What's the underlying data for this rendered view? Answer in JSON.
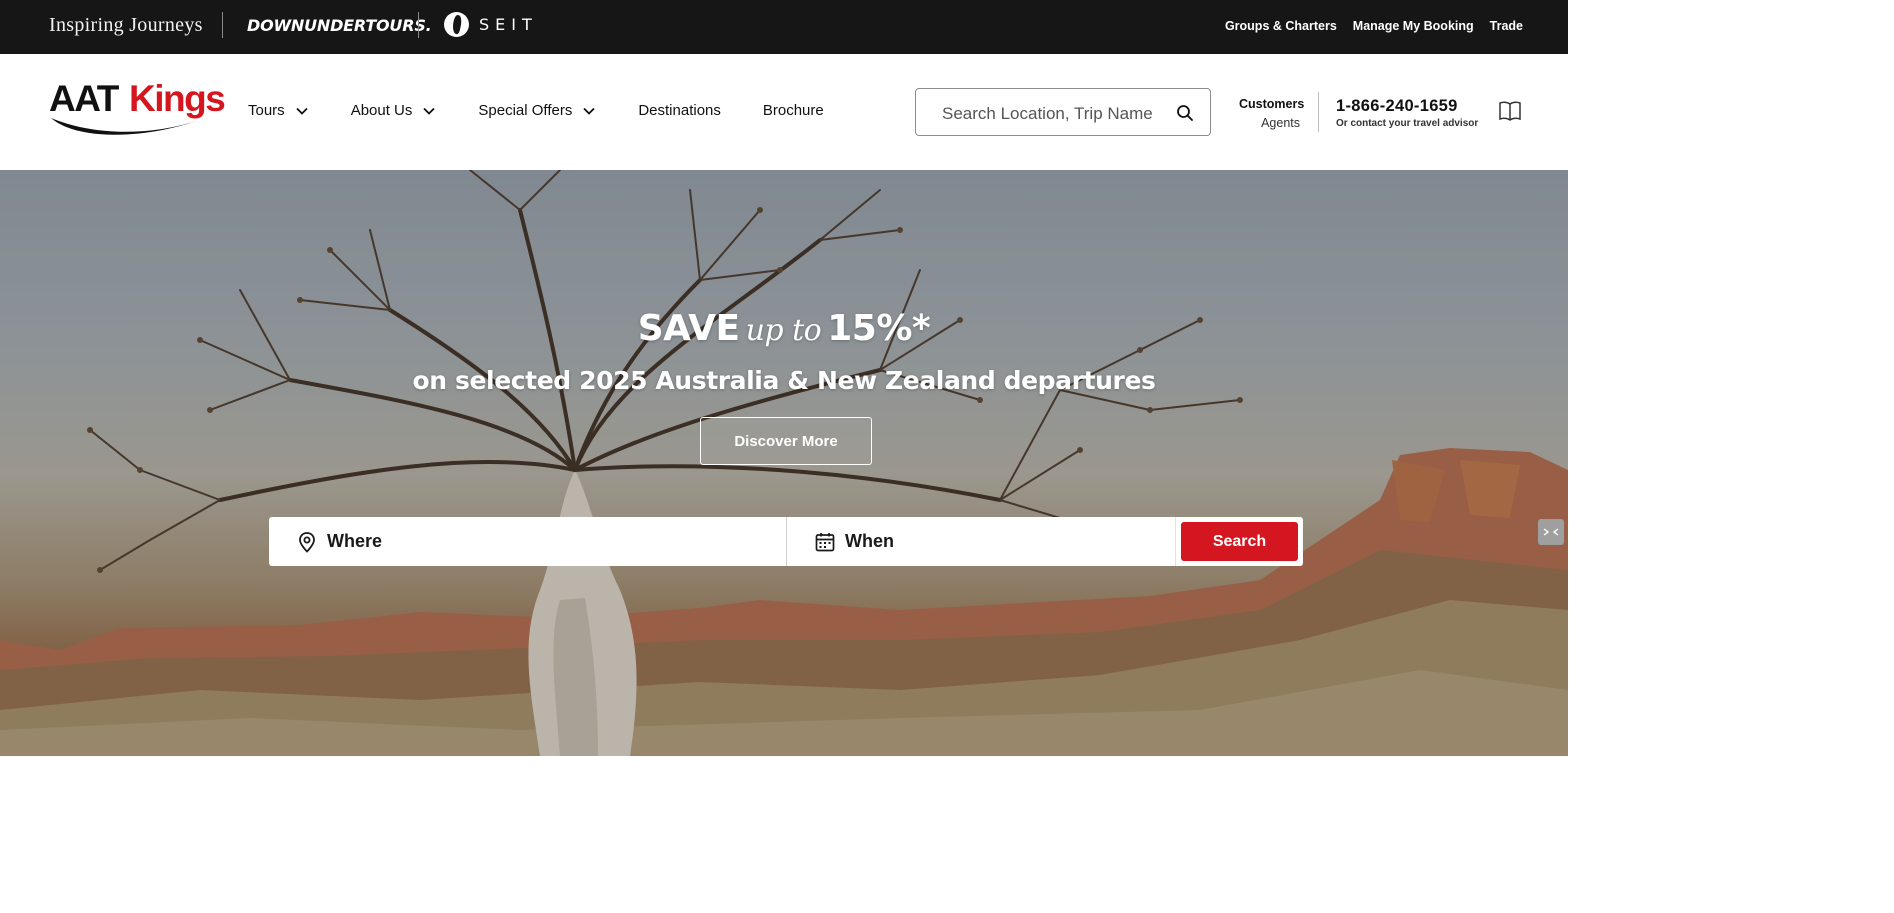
{
  "brands": {
    "inspiring_journeys": "Inspiring Journeys",
    "downunder_tours": "DOWNUNDERTOURS.",
    "seit": "SEIT"
  },
  "top_links": [
    "Groups & Charters",
    "Manage My Booking",
    "Trade"
  ],
  "logo": {
    "part1": "AAT",
    "part2": "Kings"
  },
  "nav": [
    {
      "label": "Tours",
      "dropdown": true
    },
    {
      "label": "About Us",
      "dropdown": true
    },
    {
      "label": "Special Offers",
      "dropdown": true
    },
    {
      "label": "Destinations",
      "dropdown": false
    },
    {
      "label": "Brochure",
      "dropdown": false
    }
  ],
  "search": {
    "placeholder": "Search Location, Trip Name"
  },
  "customers": {
    "line1": "Customers",
    "line2": "Agents"
  },
  "contact": {
    "phone": "1-866-240-1659",
    "sub": "Or contact your travel advisor"
  },
  "hero": {
    "save": "SAVE",
    "up_to": "up to",
    "percent": "15%*",
    "subtitle": "on selected 2025 Australia & New Zealand departures",
    "cta": "Discover More"
  },
  "finder": {
    "where": "Where",
    "when": "When",
    "button": "Search"
  },
  "colors": {
    "brand_red": "#d3161f",
    "topbar": "#161616"
  },
  "icons": [
    "location-pin-icon",
    "calendar-icon",
    "search-icon",
    "chevron-down-icon",
    "book-icon"
  ]
}
